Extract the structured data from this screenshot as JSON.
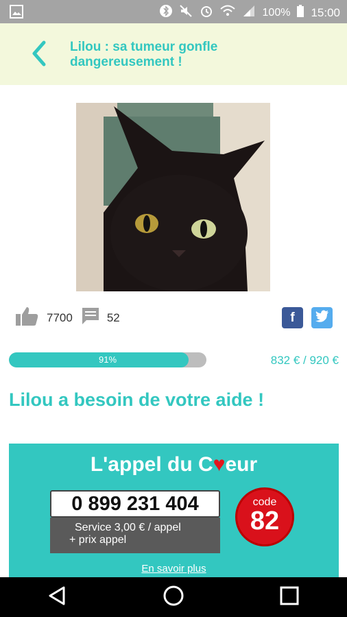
{
  "status": {
    "battery": "100%",
    "time": "15:00"
  },
  "header": {
    "title": "Lilou : sa tumeur gonfle dangereusement !"
  },
  "stats": {
    "likes": "7700",
    "comments": "52"
  },
  "progress": {
    "fraction": 0.91,
    "label": "91%",
    "amount": "832 € / 920 €"
  },
  "headline": "Lilou a besoin de votre aide !",
  "appel": {
    "title_part1": "L'appel du ",
    "title_heart_c": "C",
    "title_heart": "♥",
    "title_part2": "eur",
    "phone": "0 899 231 404",
    "service_line1": "Service 3,00 € / appel",
    "service_line2": "+ prix appel",
    "code_label": "code",
    "code_value": "82",
    "more_link": "En savoir plus"
  },
  "colors": {
    "accent": "#33c7c0",
    "header_bg": "#f3f8dc",
    "facebook": "#3b5998",
    "twitter": "#55acee",
    "code_red": "#d9111b"
  }
}
